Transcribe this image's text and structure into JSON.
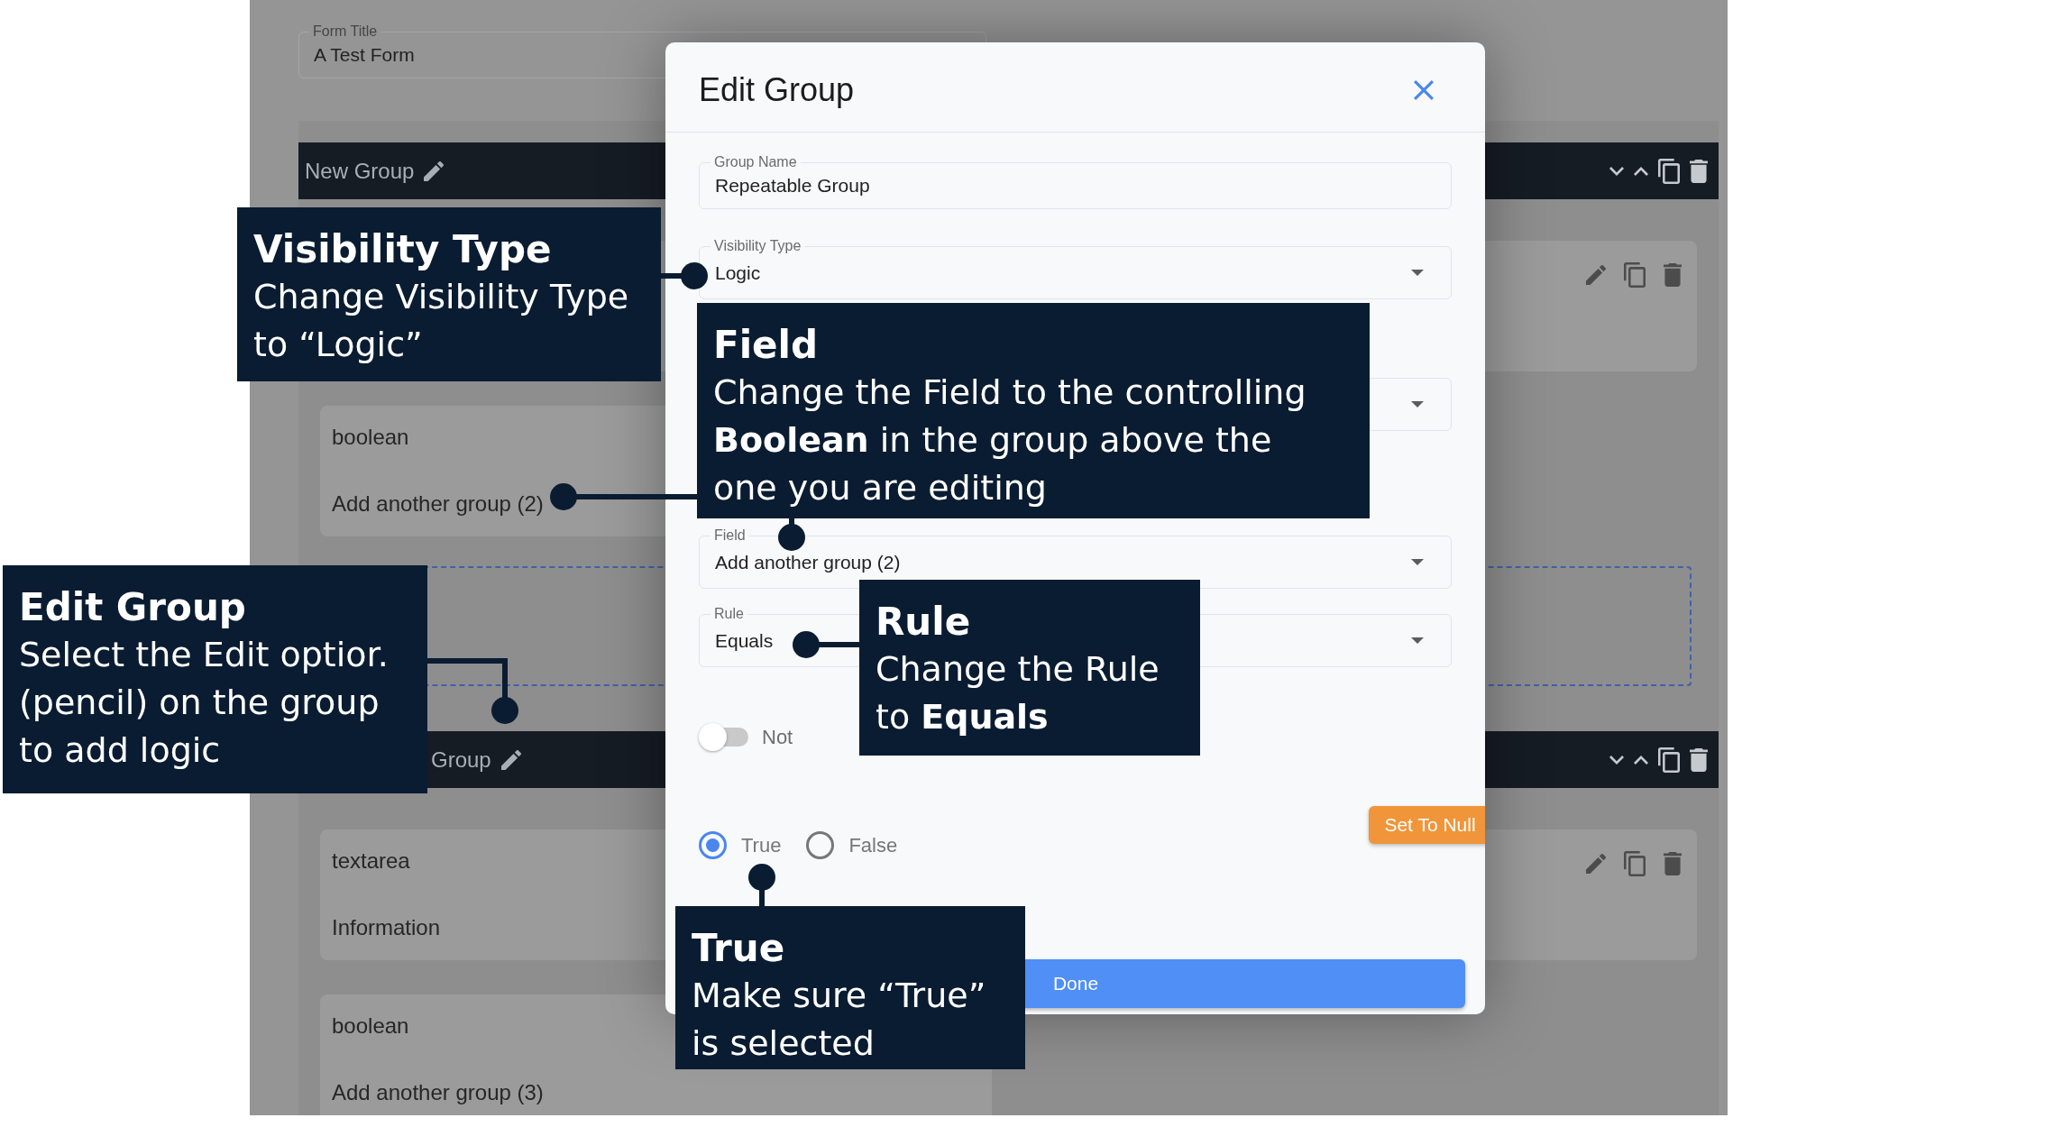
{
  "page": {
    "form_title": {
      "label": "Form Title",
      "value": "A Test Form"
    },
    "groups": [
      {
        "title": "New Group",
        "items": [
          {
            "kind": "wide"
          },
          {
            "kind": "narrow",
            "type": "boolean",
            "label": "Add another group (2)"
          },
          {
            "kind": "dropzone"
          }
        ]
      },
      {
        "title": "Group",
        "items": [
          {
            "kind": "wide",
            "type": "textarea",
            "label": "Information"
          },
          {
            "kind": "narrow",
            "type": "boolean",
            "label": "Add another group (3)"
          }
        ]
      }
    ]
  },
  "dialog": {
    "title": "Edit Group",
    "fields": [
      {
        "kind": "text",
        "label": "Group Name",
        "value": "Repeatable Group"
      },
      {
        "kind": "select",
        "label": "Visibility Type",
        "value": "Logic"
      },
      {
        "kind": "select"
      },
      {
        "kind": "select",
        "label": "Field",
        "value": "Add another group (2)"
      },
      {
        "kind": "select",
        "label": "Rule",
        "value": "Equals"
      }
    ],
    "switch": {
      "label": "Not",
      "on": false
    },
    "null_button": "Set To Null",
    "options": [
      {
        "label": "True",
        "selected": true
      },
      {
        "label": "False",
        "selected": false
      }
    ],
    "done_button": "Done"
  },
  "callouts": [
    {
      "title": "Visibility Type",
      "text": "Change Visibility Type to “Logic”"
    },
    {
      "title": "Field",
      "text": "Change the Field to the controlling **Boolean** in the group above the one you are editing"
    },
    {
      "title": "Edit Group",
      "text": "Select the Edit optior. (pencil) on the group to add logic"
    },
    {
      "title": "Rule",
      "text": "Change the Rule to **Equals**"
    },
    {
      "title": "True",
      "text": "Make sure “True” is selected"
    }
  ]
}
